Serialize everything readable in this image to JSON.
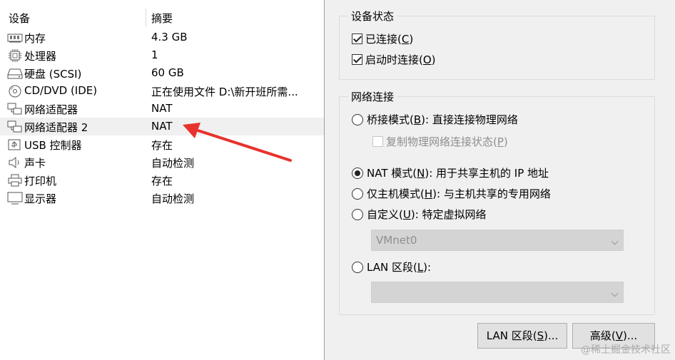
{
  "device_list": {
    "header": {
      "device": "设备",
      "summary": "摘要"
    },
    "rows": [
      {
        "name": "内存",
        "summary": "4.3 GB",
        "icon": "memory-icon"
      },
      {
        "name": "处理器",
        "summary": "1",
        "icon": "processor-icon"
      },
      {
        "name": "硬盘 (SCSI)",
        "summary": "60 GB",
        "icon": "hard-disk-icon"
      },
      {
        "name": "CD/DVD (IDE)",
        "summary": "正在使用文件 D:\\新开班所需...",
        "icon": "cd-dvd-icon"
      },
      {
        "name": "网络适配器",
        "summary": "NAT",
        "icon": "network-adapter-icon"
      },
      {
        "name": "网络适配器 2",
        "summary": "NAT",
        "icon": "network-adapter-icon",
        "selected": true
      },
      {
        "name": "USB 控制器",
        "summary": "存在",
        "icon": "usb-icon"
      },
      {
        "name": "声卡",
        "summary": "自动检测",
        "icon": "sound-card-icon"
      },
      {
        "name": "打印机",
        "summary": "存在",
        "icon": "printer-icon"
      },
      {
        "name": "显示器",
        "summary": "自动检测",
        "icon": "display-icon"
      }
    ]
  },
  "annotation": {
    "color": "#e8322d"
  },
  "device_status": {
    "title": "设备状态",
    "connected": {
      "label": "已连接(",
      "key": "C",
      "suffix": ")",
      "checked": true
    },
    "connect_at_power_on": {
      "label": "启动时连接(",
      "key": "O",
      "suffix": ")",
      "checked": true
    }
  },
  "network_connection": {
    "title": "网络连接",
    "bridged": {
      "label": "桥接模式(",
      "key": "B",
      "suffix": "): 直接连接物理网络",
      "checked": false
    },
    "replicate": {
      "label": "复制物理网络连接状态(",
      "key": "P",
      "suffix": ")",
      "checked": false,
      "disabled": true
    },
    "nat": {
      "label": "NAT 模式(",
      "key": "N",
      "suffix": "): 用于共享主机的 IP 地址",
      "checked": true
    },
    "host_only": {
      "label": "仅主机模式(",
      "key": "H",
      "suffix": "): 与主机共享的专用网络",
      "checked": false
    },
    "custom": {
      "label": "自定义(",
      "key": "U",
      "suffix": "): 特定虚拟网络",
      "checked": false
    },
    "custom_select": {
      "value": "VMnet0"
    },
    "lan_segment": {
      "label": "LAN 区段(",
      "key": "L",
      "suffix": "):",
      "checked": false
    },
    "lan_select": {
      "value": ""
    }
  },
  "buttons": {
    "lan_segments": {
      "label": "LAN 区段(",
      "key": "S",
      "suffix": ")..."
    },
    "advanced": {
      "label": "高级(",
      "key": "V",
      "suffix": ")..."
    }
  },
  "watermark": "@稀土掘金技术社区"
}
